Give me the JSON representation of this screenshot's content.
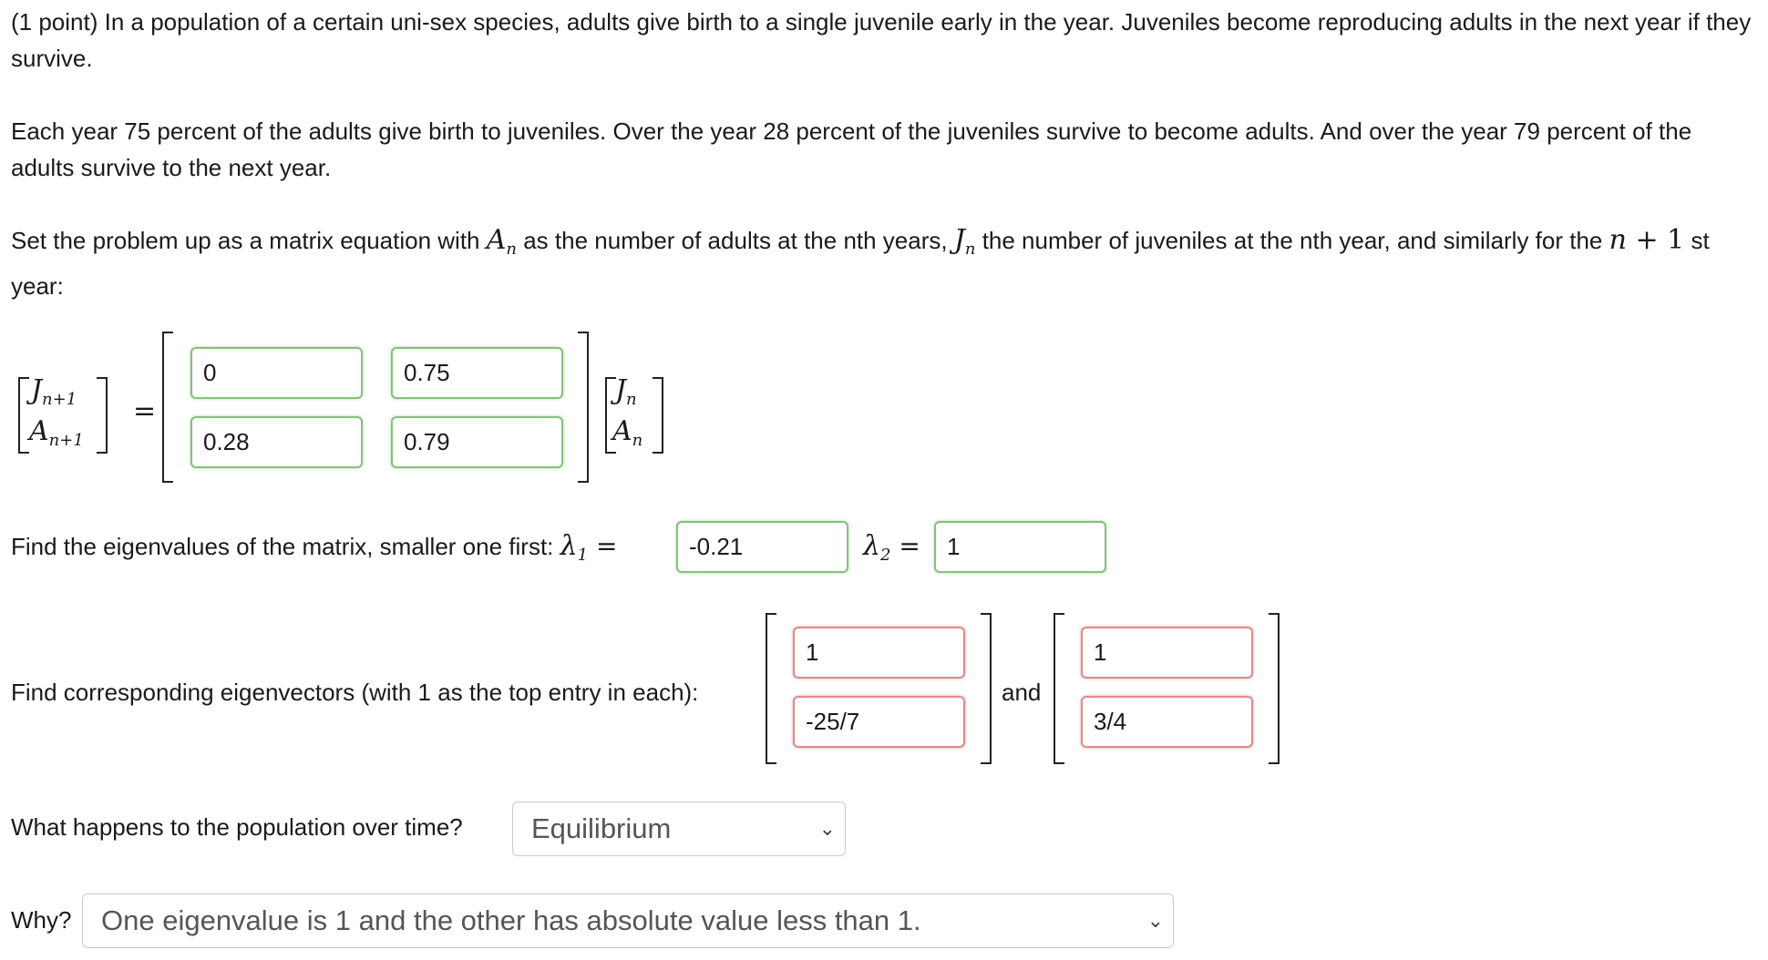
{
  "problem": {
    "p1": "(1 point) In a population of a certain uni-sex species, adults give birth to a single juvenile early in the year. Juveniles become reproducing adults in the next year if they survive.",
    "p2": "Each year 75 percent of the adults give birth to juveniles. Over the year 28 percent of the juveniles survive to become adults. And over the year 79 percent of the adults survive to the next year.",
    "p3_a": "Set the problem up as a matrix equation with ",
    "p3_A": "A",
    "p3_n": "n",
    "p3_b": " as the number of adults at the nth years, ",
    "p3_J": "J",
    "p3_c": " the number of juveniles at the nth year, and similarly for the ",
    "p3_n1": "n",
    "p3_plus": " + 1",
    "p3_d": " st year:"
  },
  "equation": {
    "lhs_top_var": "J",
    "lhs_top_sub": "n+1",
    "lhs_bot_var": "A",
    "lhs_bot_sub": "n+1",
    "equals": "=",
    "rhs_top_var": "J",
    "rhs_top_sub": "n",
    "rhs_bot_var": "A",
    "rhs_bot_sub": "n",
    "matrix": {
      "m11": "0",
      "m12": "0.75",
      "m21": "0.28",
      "m22": "0.79"
    }
  },
  "eigenvalues": {
    "prompt": "Find the eigenvalues of the matrix, smaller one first: ",
    "lambda1_sym": "λ",
    "lambda1_sub": "1",
    "lambda1_eq": " =",
    "lambda1_value": "-0.21",
    "lambda2_sym": "λ",
    "lambda2_sub": "2",
    "lambda2_eq": " =",
    "lambda2_value": "1"
  },
  "eigenvectors": {
    "prompt": "Find corresponding eigenvectors (with 1 as the top entry in each):",
    "v1_top": "1",
    "v1_bottom": "-25/7",
    "and": "and",
    "v2_top": "1",
    "v2_bottom": "3/4"
  },
  "population": {
    "prompt": "What happens to the population over time?",
    "selected": "Equilibrium"
  },
  "why": {
    "prompt": "Why?",
    "selected": "One eigenvalue is 1 and the other has absolute value less than 1."
  },
  "colors": {
    "correct_border": "#86c07a",
    "wrong_border": "#e08a8a"
  }
}
